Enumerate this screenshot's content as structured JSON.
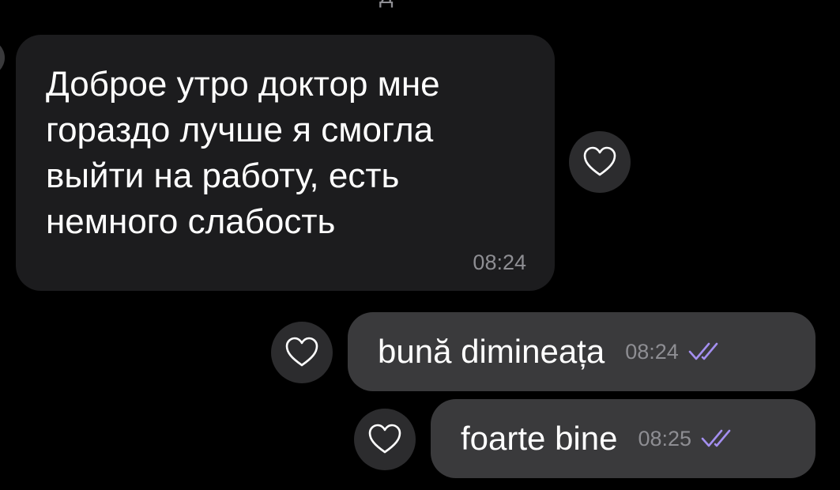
{
  "colors": {
    "background": "#000000",
    "incoming_bubble": "#1c1c1e",
    "outgoing_bubble": "#3a3a3c",
    "read_check": "#a48ff0",
    "timestamp": "#8e8e93"
  },
  "top_partial_text": "Д",
  "messages": [
    {
      "direction": "incoming",
      "text": "Доброе утро доктор мне\nгораздо лучше я смогла\nвыйти на работу, есть\nнемного слабость",
      "time": "08:24",
      "reaction_icon": "heart-outline-icon"
    },
    {
      "direction": "outgoing",
      "text": "bună dimineața",
      "time": "08:24",
      "status_icon": "double-check-icon",
      "reaction_icon": "heart-outline-icon"
    },
    {
      "direction": "outgoing",
      "text": "foarte bine",
      "time": "08:25",
      "status_icon": "double-check-icon",
      "reaction_icon": "heart-outline-icon"
    }
  ]
}
